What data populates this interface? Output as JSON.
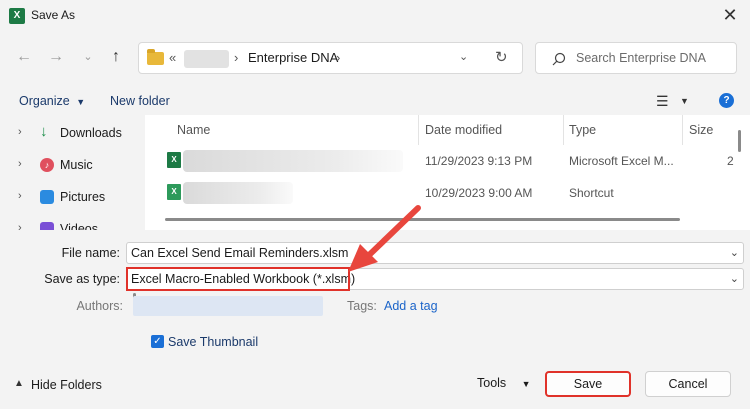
{
  "window": {
    "title": "Save As",
    "app_icon_letter": "X"
  },
  "address_bar": {
    "separator": "«",
    "current_folder": "Enterprise DNA",
    "crumb_arrow": "›"
  },
  "search": {
    "placeholder": "Search Enterprise DNA"
  },
  "toolbar": {
    "organize_label": "Organize",
    "new_folder_label": "New folder"
  },
  "nav_pane": {
    "items": [
      {
        "label": "Downloads",
        "icon": "download-icon"
      },
      {
        "label": "Music",
        "icon": "music-icon"
      },
      {
        "label": "Pictures",
        "icon": "pictures-icon"
      },
      {
        "label": "Videos",
        "icon": "videos-icon"
      }
    ]
  },
  "file_list": {
    "columns": [
      "Name",
      "Date modified",
      "Type",
      "Size"
    ],
    "rows": [
      {
        "date": "11/29/2023 9:13 PM",
        "type": "Microsoft Excel M...",
        "size": "2"
      },
      {
        "date": "10/29/2023 9:00 AM",
        "type": "Shortcut",
        "size": ""
      }
    ]
  },
  "form": {
    "file_name_label": "File name:",
    "file_name_value": "Can Excel Send Email Reminders.xlsm",
    "save_type_label": "Save as type:",
    "save_type_value": "Excel Macro-Enabled Workbook (*.xlsm)",
    "authors_label": "Authors:",
    "tags_label": "Tags:",
    "add_tag_label": "Add a tag",
    "save_thumbnail_label": "Save Thumbnail",
    "save_thumbnail_checked": true
  },
  "footer": {
    "hide_folders_label": "Hide Folders",
    "tools_label": "Tools",
    "save_label": "Save",
    "cancel_label": "Cancel"
  },
  "colors": {
    "accent": "#1a6fd6",
    "highlight_red": "#e0322a",
    "excel_green": "#1d7a45"
  }
}
